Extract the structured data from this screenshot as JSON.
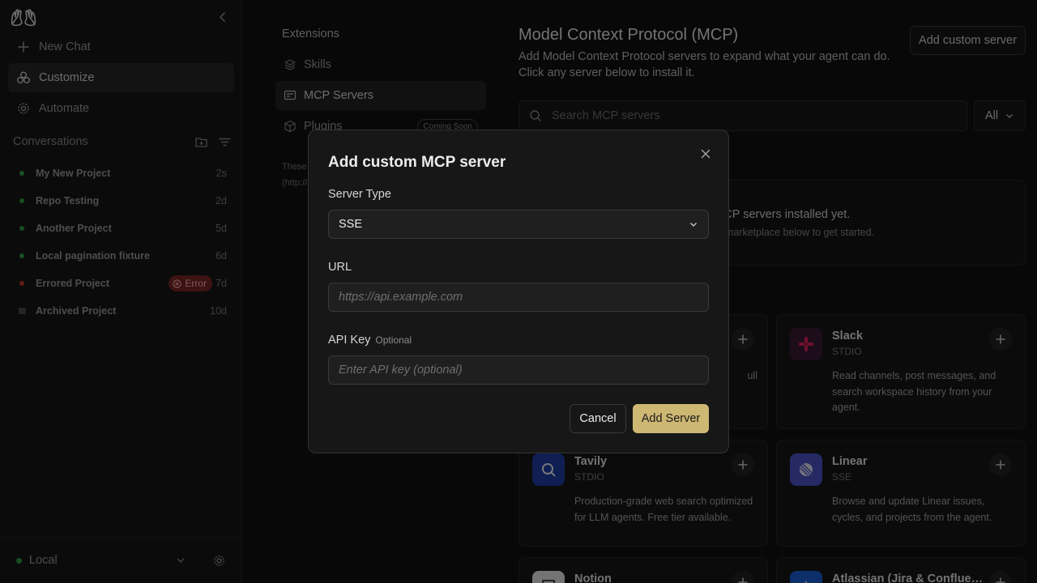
{
  "sidebar": {
    "nav": [
      {
        "label": "New Chat",
        "icon": "plus-icon"
      },
      {
        "label": "Customize",
        "icon": "customize-icon"
      },
      {
        "label": "Automate",
        "icon": "gear-icon"
      }
    ],
    "conversations_title": "Conversations",
    "conversations": [
      {
        "title": "My New Project",
        "age": "2s",
        "status": "active"
      },
      {
        "title": "Repo Testing",
        "age": "2d",
        "status": "active"
      },
      {
        "title": "Another Project",
        "age": "5d",
        "status": "active"
      },
      {
        "title": "Local pagination fixture",
        "age": "6d",
        "status": "active"
      },
      {
        "title": "Errored Project",
        "age": "7d",
        "status": "error",
        "badge": "Error"
      },
      {
        "title": "Archived Project",
        "age": "10d",
        "status": "archived"
      }
    ],
    "footer": {
      "environment": "Local"
    }
  },
  "extensions": {
    "title": "Extensions",
    "items": [
      {
        "label": "Skills"
      },
      {
        "label": "MCP Servers"
      },
      {
        "label": "Plugins",
        "badge": "Coming Soon"
      }
    ],
    "note_line1": "These",
    "note_line2": "(http://"
  },
  "main": {
    "title": "Model Context Protocol (MCP)",
    "subtitle_line1": "Add Model Context Protocol servers to expand what your agent can do.",
    "subtitle_line2": "Click any server below to install it.",
    "add_custom_label": "Add custom server",
    "search_placeholder": "Search MCP servers",
    "filter_value": "All",
    "empty_title": "No MCP servers installed yet.",
    "empty_sub": "Browse the marketplace below to get started.",
    "cards": [
      {
        "name": "",
        "type": "",
        "desc_line1": "",
        "desc_trail": "ull"
      },
      {
        "name": "Slack",
        "type": "STDIO",
        "desc": "Read channels, post messages, and search workspace history from your agent."
      },
      {
        "name": "Tavily",
        "type": "STDIO",
        "desc": "Production-grade web search optimized for LLM agents. Free tier available."
      },
      {
        "name": "Linear",
        "type": "SSE",
        "desc": "Browse and update Linear issues, cycles, and projects from the agent."
      },
      {
        "name": "Notion",
        "type": "",
        "desc": ""
      },
      {
        "name": "Atlassian (Jira & Conflue…",
        "type": "",
        "desc": ""
      }
    ],
    "colors": {
      "slack_bg": "#3a1a36",
      "tavily_bg": "#1f3ea8",
      "linear_bg": "#4b55c8",
      "notion_bg": "#e8e8e8",
      "atlassian_bg": "#1b5fd6"
    }
  },
  "modal": {
    "title": "Add custom MCP server",
    "server_type_label": "Server Type",
    "server_type_value": "SSE",
    "url_label": "URL",
    "url_placeholder": "https://api.example.com",
    "api_key_label": "API Key",
    "api_key_optional": "Optional",
    "api_key_placeholder": "Enter API key (optional)",
    "cancel_label": "Cancel",
    "add_label": "Add Server",
    "accent": "#cdb773"
  }
}
